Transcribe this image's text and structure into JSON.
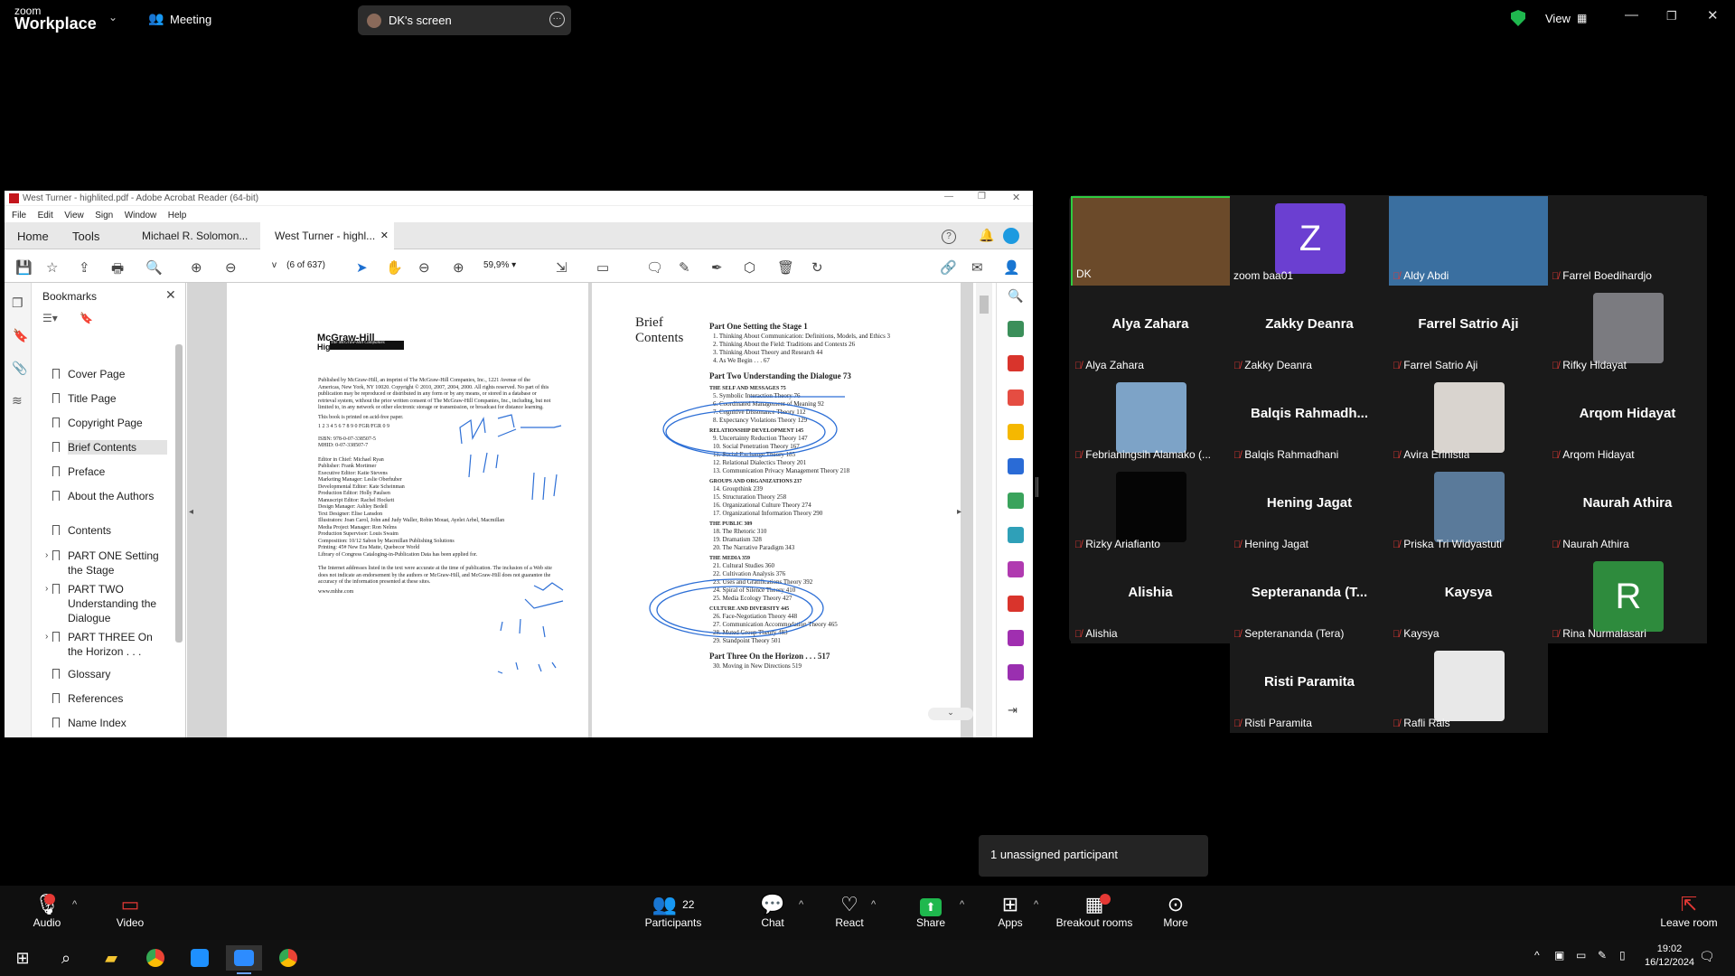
{
  "zoom": {
    "logo_top": "zoom",
    "logo_bottom": "Workplace",
    "meeting_label": "Meeting",
    "screen_share_label": "DK's screen",
    "view_label": "View",
    "unassigned": "1 unassigned participant",
    "toolbar": {
      "audio": "Audio",
      "video": "Video",
      "participants": "Participants",
      "participants_count": "22",
      "chat": "Chat",
      "react": "React",
      "share": "Share",
      "apps": "Apps",
      "breakout": "Breakout rooms",
      "more": "More",
      "leave": "Leave room"
    }
  },
  "acrobat": {
    "title": "West Turner - highlited.pdf - Adobe Acrobat Reader (64-bit)",
    "menu": [
      "File",
      "Edit",
      "View",
      "Sign",
      "Window",
      "Help"
    ],
    "tabs": {
      "home": "Home",
      "tools": "Tools",
      "doc1": "Michael R. Solomon...",
      "doc2": "West Turner - highl..."
    },
    "page_indicator": "(6 of 637)",
    "page_value": "v",
    "zoom_value": "59,9%",
    "bookmarks_title": "Bookmarks",
    "bookmarks": [
      {
        "label": "Cover Page"
      },
      {
        "label": "Title Page"
      },
      {
        "label": "Copyright Page"
      },
      {
        "label": "Brief Contents"
      },
      {
        "label": "Preface"
      },
      {
        "label": "About the Authors"
      },
      {
        "label": "Contents"
      },
      {
        "label": "PART ONE Setting the Stage"
      },
      {
        "label": "PART TWO Understanding the Dialogue"
      },
      {
        "label": "PART THREE On the Horizon . . ."
      },
      {
        "label": "Glossary"
      },
      {
        "label": "References"
      },
      {
        "label": "Name Index"
      },
      {
        "label": "Subject Index"
      }
    ],
    "doc": {
      "mh_banner": "The McGraw-Hill Companies",
      "mh_logo": [
        "McGraw-Hill",
        "Higher Education"
      ],
      "publisher_text": "Published by McGraw-Hill, an imprint of The McGraw-Hill Companies, Inc., 1221 Avenue of the Americas, New York, NY 10020. Copyright © 2010, 2007, 2004, 2000. All rights reserved. No part of this publication may be reproduced or distributed in any form or by any means, or stored in a database or retrieval system, without the prior written consent of The McGraw-Hill Companies, Inc., including, but not limited to, in any network or other electronic storage or transmission, or broadcast for distance learning.",
      "acid_free": "This book is printed on acid-free paper.",
      "print_line": "1 2 3 4 5 6 7 8 9 0 FGR/FGR 0 9",
      "isbn": "ISBN: 978-0-07-338507-5",
      "mhid": "MHID: 0-07-338507-7",
      "credits": "Editor in Chief: Michael Ryan\nPublisher: Frank Mortimer\nExecutive Editor: Katie Stevens\nMarketing Manager: Leslie Oberhuber\nDevelopmental Editor: Kate Scheinman\nProduction Editor: Holly Paulsen\nManuscript Editor: Rachel Hockett\nDesign Manager: Ashley Bedell\nText Designer: Elise Lansdon\nIllustrators: Joan Carol, John and Judy Waller, Robin Mouat, Ayelet Arbel, Macmillan\nMedia Project Manager: Ron Nelms\nProduction Supervisor: Louis Swaim\nComposition: 10/12 Sabon by Macmillan Publishing Solutions\nPrinting: 45# New Era Matte, Quebecor World",
      "loc": "Library of Congress Cataloging-in-Publication Data has been applied for.",
      "disclaimer": "The Internet addresses listed in the text were accurate at the time of publication. The inclusion of a Web site does not indicate an endorsement by the authors or McGraw-Hill, and McGraw-Hill does not guarantee the accuracy of the information presented at these sites.",
      "url": "www.mhhe.com",
      "brief_contents": "Brief Contents",
      "toc": [
        {
          "k": "h",
          "t": "Part One   Setting the Stage   1"
        },
        {
          "k": "i",
          "t": "1.  Thinking About Communication: Definitions, Models, and Ethics   3"
        },
        {
          "k": "i",
          "t": "2.  Thinking About the Field: Traditions and Contexts   26"
        },
        {
          "k": "i",
          "t": "3.  Thinking About Theory and Research   44"
        },
        {
          "k": "i",
          "t": "4.  As We Begin . . .   67"
        },
        {
          "k": "h",
          "t": "Part Two   Understanding the Dialogue   73"
        },
        {
          "k": "s",
          "t": "THE SELF AND MESSAGES   75"
        },
        {
          "k": "i",
          "t": "5.  Symbolic Interaction Theory   76"
        },
        {
          "k": "i",
          "t": "6.  Coordinated Management of Meaning   92"
        },
        {
          "k": "i",
          "t": "7.  Cognitive Dissonance Theory   112"
        },
        {
          "k": "i",
          "t": "8.  Expectancy Violations Theory   129"
        },
        {
          "k": "s",
          "t": "RELATIONSHIP DEVELOPMENT   145"
        },
        {
          "k": "i",
          "t": "9.  Uncertainty Reduction Theory   147"
        },
        {
          "k": "i",
          "t": "10. Social Penetration Theory   167"
        },
        {
          "k": "i",
          "t": "11. Social Exchange Theory   185"
        },
        {
          "k": "i",
          "t": "12. Relational Dialectics Theory   201"
        },
        {
          "k": "i",
          "t": "13. Communication Privacy Management Theory   218"
        },
        {
          "k": "s",
          "t": "GROUPS AND ORGANIZATIONS   237"
        },
        {
          "k": "i",
          "t": "14. Groupthink   239"
        },
        {
          "k": "i",
          "t": "15. Structuration Theory   258"
        },
        {
          "k": "i",
          "t": "16. Organizational Culture Theory   274"
        },
        {
          "k": "i",
          "t": "17. Organizational Information Theory   290"
        },
        {
          "k": "s",
          "t": "THE PUBLIC   309"
        },
        {
          "k": "i",
          "t": "18. The Rhetoric   310"
        },
        {
          "k": "i",
          "t": "19. Dramatism   328"
        },
        {
          "k": "i",
          "t": "20. The Narrative Paradigm   343"
        },
        {
          "k": "s",
          "t": "THE MEDIA   359"
        },
        {
          "k": "i",
          "t": "21. Cultural Studies   360"
        },
        {
          "k": "i",
          "t": "22. Cultivation Analysis   376"
        },
        {
          "k": "i",
          "t": "23. Uses and Gratifications Theory   392"
        },
        {
          "k": "i",
          "t": "24. Spiral of Silence Theory   410"
        },
        {
          "k": "i",
          "t": "25. Media Ecology Theory   427"
        },
        {
          "k": "s",
          "t": "CULTURE AND DIVERSITY   445"
        },
        {
          "k": "i",
          "t": "26. Face-Negotiation Theory   448"
        },
        {
          "k": "i",
          "t": "27. Communication Accommodation Theory   465"
        },
        {
          "k": "i",
          "t": "28. Muted Group Theory   483"
        },
        {
          "k": "i",
          "t": "29. Standpoint Theory   501"
        },
        {
          "k": "h",
          "t": "Part Three   On the Horizon . . .   517"
        },
        {
          "k": "i",
          "t": "30. Moving in New Directions   519"
        }
      ]
    }
  },
  "participants": [
    {
      "name": "",
      "label": "DK",
      "type": "video",
      "color": "#6b4a2a",
      "muted": false
    },
    {
      "name": "",
      "label": "zoom baa01",
      "type": "letter",
      "letter": "Z",
      "color": "#6b3fd1",
      "muted": false
    },
    {
      "name": "",
      "label": "Aldy Abdi",
      "type": "video",
      "color": "#3a6fa0",
      "muted": true
    },
    {
      "name": "",
      "label": "Farrel Boedihardjo",
      "type": "blank",
      "muted": true
    },
    {
      "name": "Alya Zahara",
      "label": "Alya Zahara",
      "type": "text",
      "muted": true
    },
    {
      "name": "Zakky Deanra",
      "label": "Zakky Deanra",
      "type": "text",
      "muted": true
    },
    {
      "name": "Farrel Satrio Aji",
      "label": "Farrel Satrio Aji",
      "type": "text",
      "muted": true
    },
    {
      "name": "",
      "label": "Rifky Hidayat",
      "type": "photo",
      "color": "#7b7b80",
      "muted": true
    },
    {
      "name": "",
      "label": "Febrianingsih Alamako (...",
      "type": "photo",
      "color": "#7da3c7",
      "muted": true
    },
    {
      "name": "Balqis  Rahmadh...",
      "label": "Balqis Rahmadhani",
      "type": "text",
      "muted": true
    },
    {
      "name": "",
      "label": "Avira Erinistia",
      "type": "photo",
      "color": "#d9d4cf",
      "muted": true
    },
    {
      "name": "Arqom Hidayat",
      "label": "Arqom Hidayat",
      "type": "text",
      "muted": true
    },
    {
      "name": "",
      "label": "Rizky Ariafianto",
      "type": "photo",
      "color": "#050505",
      "muted": true
    },
    {
      "name": "Hening Jagat",
      "label": "Hening Jagat",
      "type": "text",
      "muted": true
    },
    {
      "name": "",
      "label": "Priska Tri Widyastuti",
      "type": "photo",
      "color": "#5a7a9a",
      "muted": true
    },
    {
      "name": "Naurah Athira",
      "label": "Naurah Athira",
      "type": "text",
      "muted": true
    },
    {
      "name": "Alishia",
      "label": "Alishia",
      "type": "text",
      "muted": true
    },
    {
      "name": "Septerananda  (T...",
      "label": "Septerananda (Tera)",
      "type": "text",
      "muted": true
    },
    {
      "name": "Kaysya",
      "label": "Kaysya",
      "type": "text",
      "muted": true
    },
    {
      "name": "",
      "label": "Rina Nurmalasari",
      "type": "letter",
      "letter": "R",
      "color": "#2e8b3d",
      "muted": true
    },
    {
      "name": "Risti Paramita",
      "label": "Risti Paramita",
      "type": "text",
      "muted": true
    },
    {
      "name": "",
      "label": "Rafli Rais",
      "type": "photo",
      "color": "#e8e8e8",
      "muted": true
    }
  ],
  "taskbar": {
    "time": "19:02",
    "date": "16/12/2024"
  },
  "colors": {
    "accent_green": "#1fb84e",
    "mute_red": "#e53935",
    "share_green": "#1fb84e",
    "active_speaker": "#2ecc40"
  }
}
